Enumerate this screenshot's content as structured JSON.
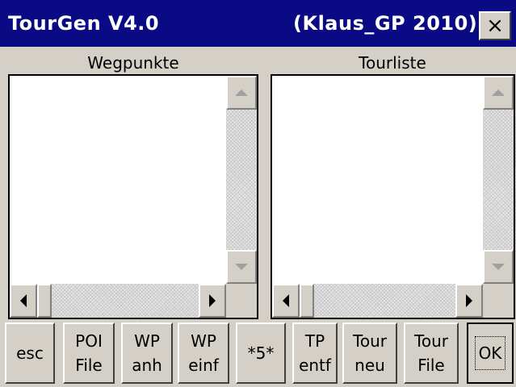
{
  "window": {
    "title": "TourGen V4.0",
    "subtitle": "(Klaus_GP 2010)",
    "close_label": "×"
  },
  "panes": {
    "left_label": "Wegpunkte",
    "right_label": "Tourliste"
  },
  "buttons": [
    {
      "line1": "esc",
      "line2": ""
    },
    {
      "line1": "POI",
      "line2": "File"
    },
    {
      "line1": "WP",
      "line2": "anh"
    },
    {
      "line1": "WP",
      "line2": "einf"
    },
    {
      "line1": "*5*",
      "line2": ""
    },
    {
      "line1": "TP",
      "line2": "entf"
    },
    {
      "line1": "Tour",
      "line2": "neu"
    },
    {
      "line1": "Tour",
      "line2": "File"
    },
    {
      "line1": "OK",
      "line2": ""
    }
  ],
  "colors": {
    "titlebar": "#0a0a84",
    "face": "#d4d0c8"
  }
}
